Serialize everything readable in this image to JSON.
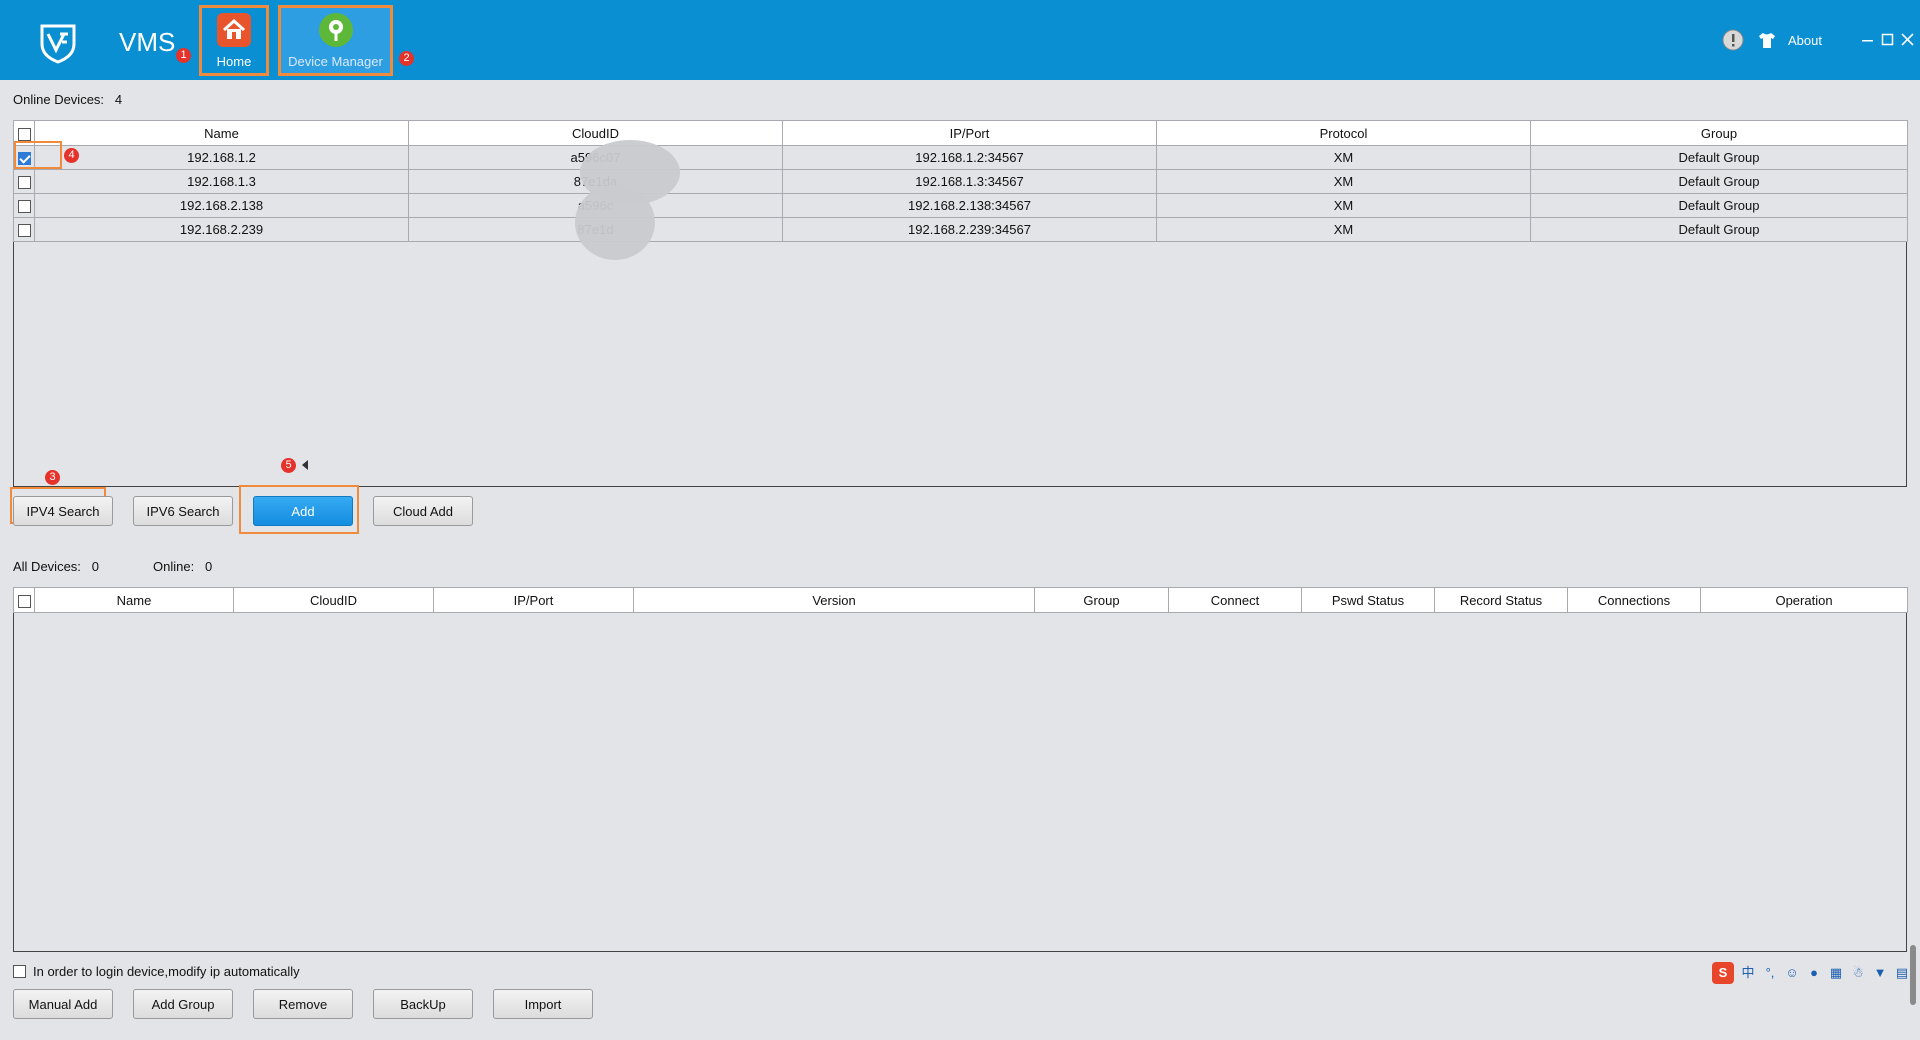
{
  "app": {
    "title": "VMS"
  },
  "nav": [
    {
      "label": "Home",
      "badge": "1"
    },
    {
      "label": "Device Manager",
      "badge": "2"
    }
  ],
  "window": {
    "about": "About"
  },
  "online": {
    "label": "Online Devices:",
    "count": "4"
  },
  "search_table": {
    "headers": [
      "Name",
      "CloudID",
      "IP/Port",
      "Protocol",
      "Group"
    ],
    "rows": [
      {
        "checked": true,
        "name": "192.168.1.2",
        "cloudid": "a596c07",
        "ip": "192.168.1.2:34567",
        "protocol": "XM",
        "group": "Default Group"
      },
      {
        "checked": false,
        "name": "192.168.1.3",
        "cloudid": "87e1da",
        "ip": "192.168.1.3:34567",
        "protocol": "XM",
        "group": "Default Group"
      },
      {
        "checked": false,
        "name": "192.168.2.138",
        "cloudid": "a596c",
        "ip": "192.168.2.138:34567",
        "protocol": "XM",
        "group": "Default Group"
      },
      {
        "checked": false,
        "name": "192.168.2.239",
        "cloudid": "87e1d",
        "ip": "192.168.2.239:34567",
        "protocol": "XM",
        "group": "Default Group"
      }
    ]
  },
  "search_buttons": {
    "ipv4": "IPV4 Search",
    "ipv6": "IPV6 Search",
    "add": "Add",
    "cloud_add": "Cloud Add"
  },
  "badges": {
    "ipv4": "3",
    "checkbox": "4",
    "add": "5"
  },
  "summary": {
    "all_label": "All Devices:",
    "all_count": "0",
    "online_label": "Online:",
    "online_count": "0"
  },
  "device_table": {
    "headers": [
      "Name",
      "CloudID",
      "IP/Port",
      "Version",
      "Group",
      "Connect",
      "Pswd Status",
      "Record Status",
      "Connections",
      "Operation"
    ]
  },
  "auto_ip": {
    "label": "In order to login device,modify ip automatically",
    "checked": false
  },
  "bottom_buttons": {
    "manual_add": "Manual Add",
    "add_group": "Add Group",
    "remove": "Remove",
    "backup": "BackUp",
    "import": "Import"
  },
  "ime": {
    "logo": "S",
    "lang": "中"
  },
  "colors": {
    "titlebar": "#0a8fd2",
    "highlight": "#f08a3c",
    "badge": "#e5322b",
    "primary": "#1a92e3"
  }
}
